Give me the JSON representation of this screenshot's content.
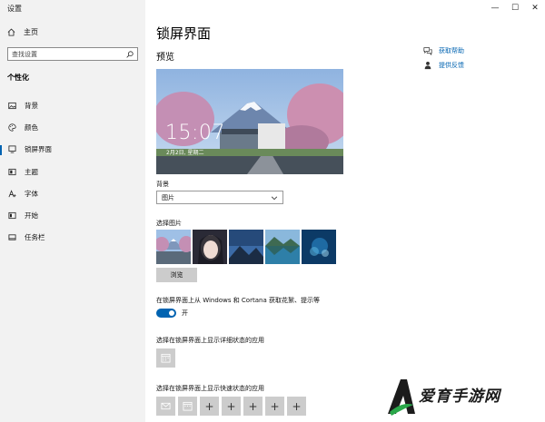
{
  "window": {
    "title": "设置",
    "controls": {
      "minimize": "—",
      "maximize": "☐",
      "close": "✕"
    }
  },
  "sidebar": {
    "home_label": "主页",
    "search_placeholder": "查找设置",
    "section_title": "个性化",
    "items": [
      {
        "label": "背景",
        "icon": "image-icon"
      },
      {
        "label": "颜色",
        "icon": "palette-icon"
      },
      {
        "label": "锁屏界面",
        "icon": "lock-screen-icon",
        "active": true
      },
      {
        "label": "主题",
        "icon": "theme-icon"
      },
      {
        "label": "字体",
        "icon": "font-icon"
      },
      {
        "label": "开始",
        "icon": "start-icon"
      },
      {
        "label": "任务栏",
        "icon": "taskbar-icon"
      }
    ]
  },
  "main": {
    "title": "锁屏界面",
    "preview_heading": "预览",
    "preview": {
      "time": "15:07",
      "date": "2月2日, 星期二"
    },
    "background_label": "背景",
    "background_value": "图片",
    "choose_picture_label": "选择图片",
    "browse_label": "浏览",
    "fun_facts_label": "在锁屏界面上从 Windows 和 Cortana 获取花絮、提示等",
    "toggle_state": "开",
    "detailed_app_label": "选择在锁屏界面上显示详细状态的应用",
    "quick_app_label": "选择在锁屏界面上显示快速状态的应用",
    "plus": "+"
  },
  "help": {
    "get_help": "获取帮助",
    "feedback": "提供反馈"
  },
  "watermark": {
    "text": "爱育手游网"
  },
  "colors": {
    "accent": "#0063b1",
    "sidebar_bg": "#f2f2f2"
  }
}
